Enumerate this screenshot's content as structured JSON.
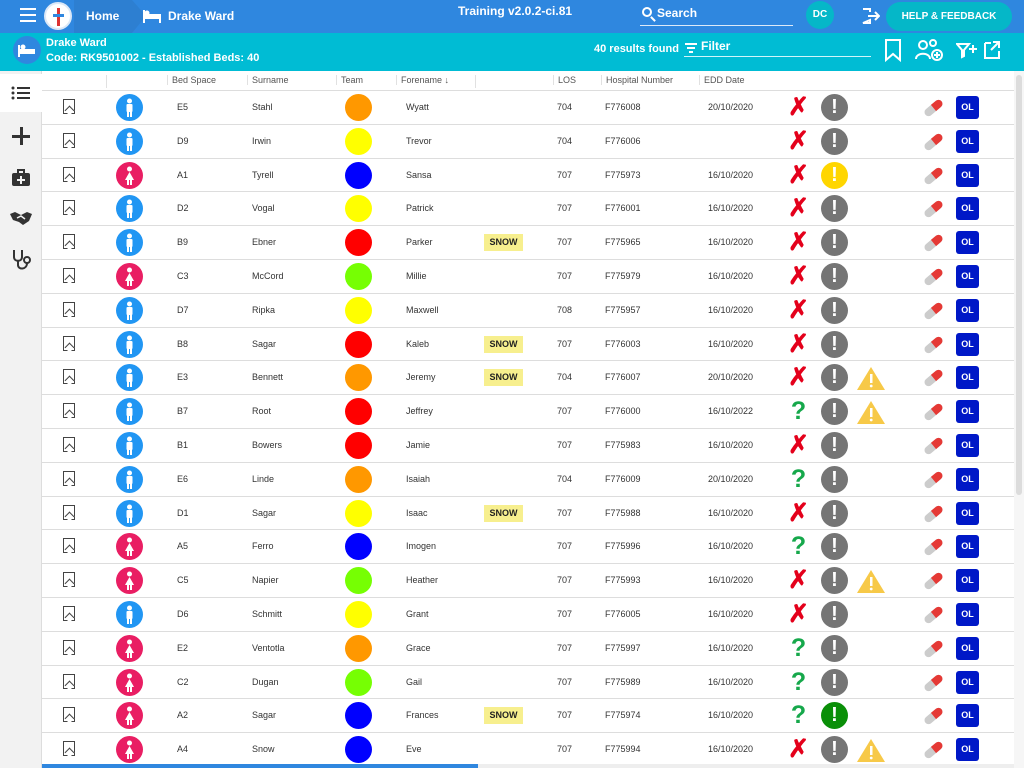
{
  "topbar": {
    "home_label": "Home",
    "ward_label": "Drake Ward",
    "version": "Training v2.0.2-ci.81",
    "search_placeholder": "Search",
    "user_initials": "DC",
    "help_label": "HELP & FEEDBACK"
  },
  "ward": {
    "title": "Drake Ward",
    "code_line": "Code: RK9501002 - Established Beds: 40"
  },
  "toolbar": {
    "results_label": "40 results found",
    "filter_placeholder": "Filter"
  },
  "nav": {
    "items": [
      "list-icon",
      "plus-icon",
      "medical-kit-icon",
      "handshake-icon",
      "stethoscope-icon"
    ]
  },
  "table": {
    "headers": {
      "bed_space": "Bed Space",
      "surname": "Surname",
      "team": "Team",
      "forename": "Forename",
      "los": "LOS",
      "hospital_number": "Hospital Number",
      "edd": "EDD Date"
    },
    "rows": [
      {
        "gender": "male",
        "bed": "E5",
        "surname": "Stahl",
        "team": "#ff9800",
        "forename": "Wyatt",
        "tag": "",
        "los": "704",
        "hosp": "F776008",
        "edd": "20/10/2020",
        "status": "x",
        "alert": "grey",
        "warn": false,
        "ol": "OL"
      },
      {
        "gender": "male",
        "bed": "D9",
        "surname": "Irwin",
        "team": "#ffff00",
        "forename": "Trevor",
        "tag": "",
        "los": "704",
        "hosp": "F776006",
        "edd": "",
        "status": "x",
        "alert": "grey",
        "warn": false,
        "ol": "OL"
      },
      {
        "gender": "female",
        "bed": "A1",
        "surname": "Tyrell",
        "team": "#0000ff",
        "forename": "Sansa",
        "tag": "",
        "los": "707",
        "hosp": "F775973",
        "edd": "16/10/2020",
        "status": "x",
        "alert": "yellow",
        "warn": false,
        "ol": "OL"
      },
      {
        "gender": "male",
        "bed": "D2",
        "surname": "Vogal",
        "team": "#ffff00",
        "forename": "Patrick",
        "tag": "",
        "los": "707",
        "hosp": "F776001",
        "edd": "16/10/2020",
        "status": "x",
        "alert": "grey",
        "warn": false,
        "ol": "OL"
      },
      {
        "gender": "male",
        "bed": "B9",
        "surname": "Ebner",
        "team": "#ff0000",
        "forename": "Parker",
        "tag": "SNOW",
        "los": "707",
        "hosp": "F775965",
        "edd": "16/10/2020",
        "status": "x",
        "alert": "grey",
        "warn": false,
        "ol": "OL"
      },
      {
        "gender": "female",
        "bed": "C3",
        "surname": "McCord",
        "team": "#76ff03",
        "forename": "Millie",
        "tag": "",
        "los": "707",
        "hosp": "F775979",
        "edd": "16/10/2020",
        "status": "x",
        "alert": "grey",
        "warn": false,
        "ol": "OL"
      },
      {
        "gender": "male",
        "bed": "D7",
        "surname": "Ripka",
        "team": "#ffff00",
        "forename": "Maxwell",
        "tag": "",
        "los": "708",
        "hosp": "F775957",
        "edd": "16/10/2020",
        "status": "x",
        "alert": "grey",
        "warn": false,
        "ol": "OL"
      },
      {
        "gender": "male",
        "bed": "B8",
        "surname": "Sagar",
        "team": "#ff0000",
        "forename": "Kaleb",
        "tag": "SNOW",
        "los": "707",
        "hosp": "F776003",
        "edd": "16/10/2020",
        "status": "x",
        "alert": "grey",
        "warn": false,
        "ol": "OL"
      },
      {
        "gender": "male",
        "bed": "E3",
        "surname": "Bennett",
        "team": "#ff9800",
        "forename": "Jeremy",
        "tag": "SNOW",
        "los": "704",
        "hosp": "F776007",
        "edd": "20/10/2020",
        "status": "x",
        "alert": "grey",
        "warn": true,
        "ol": "OL"
      },
      {
        "gender": "male",
        "bed": "B7",
        "surname": "Root",
        "team": "#ff0000",
        "forename": "Jeffrey",
        "tag": "",
        "los": "707",
        "hosp": "F776000",
        "edd": "16/10/2022",
        "status": "?",
        "alert": "grey",
        "warn": true,
        "ol": "OL"
      },
      {
        "gender": "male",
        "bed": "B1",
        "surname": "Bowers",
        "team": "#ff0000",
        "forename": "Jamie",
        "tag": "",
        "los": "707",
        "hosp": "F775983",
        "edd": "16/10/2020",
        "status": "x",
        "alert": "grey",
        "warn": false,
        "ol": "OL"
      },
      {
        "gender": "male",
        "bed": "E6",
        "surname": "Linde",
        "team": "#ff9800",
        "forename": "Isaiah",
        "tag": "",
        "los": "704",
        "hosp": "F776009",
        "edd": "20/10/2020",
        "status": "?",
        "alert": "grey",
        "warn": false,
        "ol": "OL"
      },
      {
        "gender": "male",
        "bed": "D1",
        "surname": "Sagar",
        "team": "#ffff00",
        "forename": "Isaac",
        "tag": "SNOW",
        "los": "707",
        "hosp": "F775988",
        "edd": "16/10/2020",
        "status": "x",
        "alert": "grey",
        "warn": false,
        "ol": "OL"
      },
      {
        "gender": "female",
        "bed": "A5",
        "surname": "Ferro",
        "team": "#0000ff",
        "forename": "Imogen",
        "tag": "",
        "los": "707",
        "hosp": "F775996",
        "edd": "16/10/2020",
        "status": "?",
        "alert": "grey",
        "warn": false,
        "ol": "OL"
      },
      {
        "gender": "female",
        "bed": "C5",
        "surname": "Napier",
        "team": "#76ff03",
        "forename": "Heather",
        "tag": "",
        "los": "707",
        "hosp": "F775993",
        "edd": "16/10/2020",
        "status": "x",
        "alert": "grey",
        "warn": true,
        "ol": "OL"
      },
      {
        "gender": "male",
        "bed": "D6",
        "surname": "Schmitt",
        "team": "#ffff00",
        "forename": "Grant",
        "tag": "",
        "los": "707",
        "hosp": "F776005",
        "edd": "16/10/2020",
        "status": "x",
        "alert": "grey",
        "warn": false,
        "ol": "OL"
      },
      {
        "gender": "female",
        "bed": "E2",
        "surname": "Ventotla",
        "team": "#ff9800",
        "forename": "Grace",
        "tag": "",
        "los": "707",
        "hosp": "F775997",
        "edd": "16/10/2020",
        "status": "?",
        "alert": "grey",
        "warn": false,
        "ol": "OL"
      },
      {
        "gender": "female",
        "bed": "C2",
        "surname": "Dugan",
        "team": "#76ff03",
        "forename": "Gail",
        "tag": "",
        "los": "707",
        "hosp": "F775989",
        "edd": "16/10/2020",
        "status": "?",
        "alert": "grey",
        "warn": false,
        "ol": "OL"
      },
      {
        "gender": "female",
        "bed": "A2",
        "surname": "Sagar",
        "team": "#0000ff",
        "forename": "Frances",
        "tag": "SNOW",
        "los": "707",
        "hosp": "F775974",
        "edd": "16/10/2020",
        "status": "?",
        "alert": "green",
        "warn": false,
        "ol": "OL"
      },
      {
        "gender": "female",
        "bed": "A4",
        "surname": "Snow",
        "team": "#0000ff",
        "forename": "Eve",
        "tag": "",
        "los": "707",
        "hosp": "F775994",
        "edd": "16/10/2020",
        "status": "x",
        "alert": "grey",
        "warn": true,
        "ol": "OL"
      }
    ]
  },
  "colors": {
    "topbar": "#2f87df",
    "subbar": "#00bcd4",
    "male": "#2196f3",
    "female": "#e91e63",
    "x_red": "#e4001b",
    "question_green": "#16a84b",
    "alert_grey": "#757575",
    "alert_yellow": "#ffd600",
    "alert_green": "#0a8f08",
    "ol_blue": "#0018c7"
  }
}
